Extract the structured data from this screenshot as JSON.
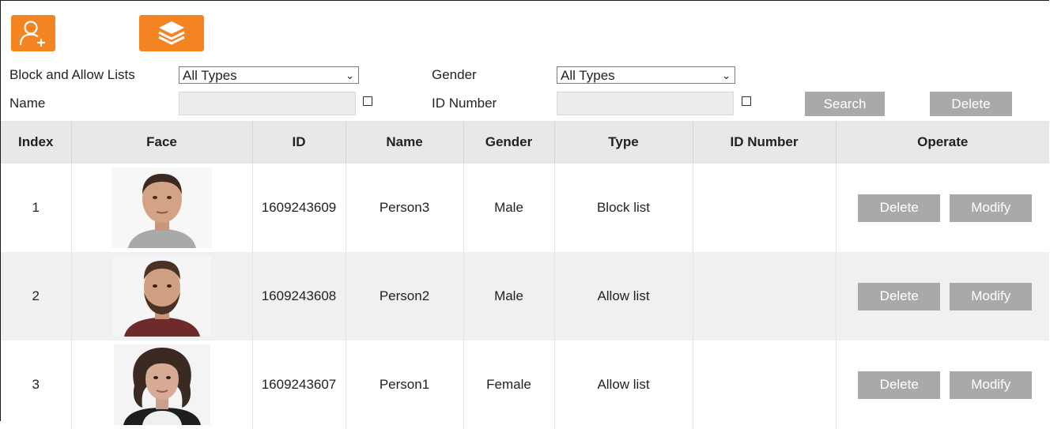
{
  "toolbar": {
    "add_icon": "add-person-icon",
    "layers_icon": "layers-icon",
    "accent": "#f48322"
  },
  "filters": {
    "list_label": "Block and Allow Lists",
    "list_value": "All Types",
    "gender_label": "Gender",
    "gender_value": "All Types",
    "name_label": "Name",
    "name_value": "",
    "id_number_label": "ID Number",
    "id_number_value": "",
    "search_label": "Search",
    "delete_label": "Delete"
  },
  "table": {
    "headers": [
      "Index",
      "Face",
      "ID",
      "Name",
      "Gender",
      "Type",
      "ID Number",
      "Operate"
    ],
    "rows": [
      {
        "index": "1",
        "id": "1609243609",
        "name": "Person3",
        "gender": "Male",
        "type": "Block list",
        "id_number": "",
        "delete_label": "Delete",
        "modify_label": "Modify"
      },
      {
        "index": "2",
        "id": "1609243608",
        "name": "Person2",
        "gender": "Male",
        "type": "Allow list",
        "id_number": "",
        "delete_label": "Delete",
        "modify_label": "Modify"
      },
      {
        "index": "3",
        "id": "1609243607",
        "name": "Person1",
        "gender": "Female",
        "type": "Allow list",
        "id_number": "",
        "delete_label": "Delete",
        "modify_label": "Modify"
      }
    ]
  }
}
